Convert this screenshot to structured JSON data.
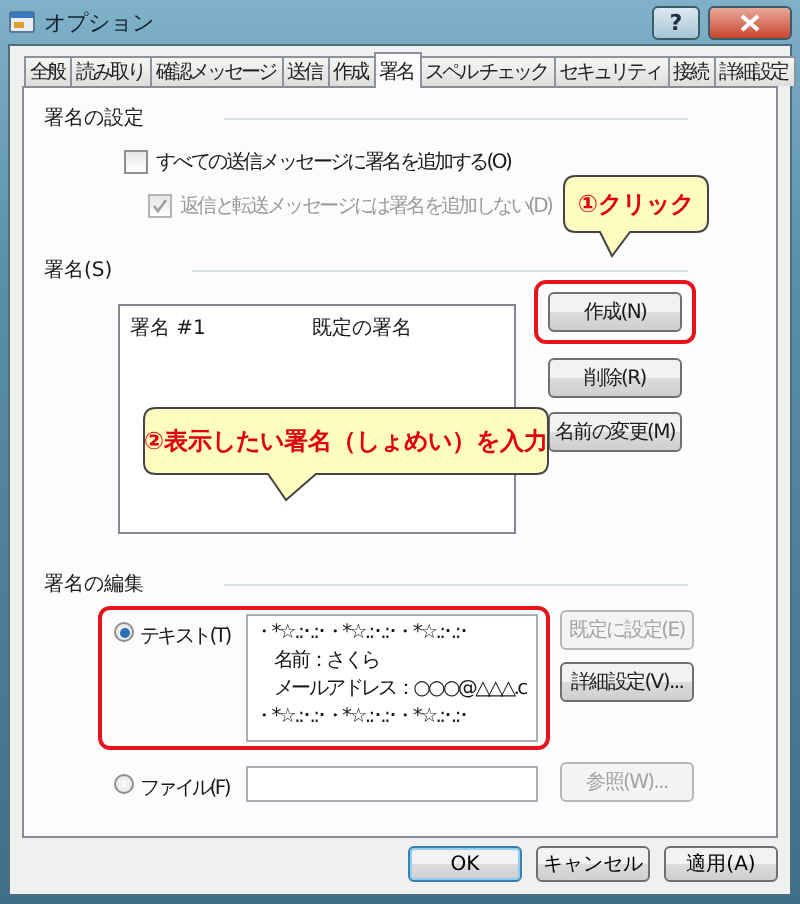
{
  "window": {
    "title": "オプション",
    "help_button": "?"
  },
  "tabs": [
    {
      "label": "全般",
      "selected": false
    },
    {
      "label": "読み取り",
      "selected": false
    },
    {
      "label": "確認メッセージ",
      "selected": false
    },
    {
      "label": "送信",
      "selected": false
    },
    {
      "label": "作成",
      "selected": false
    },
    {
      "label": "署名",
      "selected": true
    },
    {
      "label": "スペル チェック",
      "selected": false
    },
    {
      "label": "セキュリティ",
      "selected": false
    },
    {
      "label": "接続",
      "selected": false
    },
    {
      "label": "詳細設定",
      "selected": false
    }
  ],
  "signature_settings": {
    "heading": "署名の設定",
    "options": [
      {
        "label": "すべての送信メッセージに署名を追加する(O)",
        "checked": false,
        "disabled": false
      },
      {
        "label": "返信と転送メッセージには署名を追加しない(D)",
        "checked": true,
        "disabled": true
      }
    ]
  },
  "signatures": {
    "heading": "署名(S)",
    "rows": [
      {
        "name": "署名 #1",
        "note": "既定の署名",
        "selected": false
      }
    ],
    "buttons": [
      {
        "label": "作成(N)",
        "disabled": false,
        "highlighted": true
      },
      {
        "label": "削除(R)",
        "disabled": false,
        "highlighted": false
      },
      {
        "label": "名前の変更(M)",
        "disabled": false,
        "highlighted": false
      }
    ]
  },
  "signature_edit": {
    "heading": "署名の編集",
    "sources": [
      {
        "label": "テキスト(T)",
        "kind": "text",
        "selected": true,
        "highlighted": true,
        "lines": [
          {
            "text": "・*☆.:･.:･・*☆.:･.:･・*☆.:･.:･",
            "kind": "border"
          },
          {
            "text": "名前：さくら",
            "kind": "field"
          },
          {
            "text": "メールアドレス：○○○@△△△.c",
            "kind": "field"
          },
          {
            "text": "・*☆.:･.:･・*☆.:･.:･・*☆.:･.:･",
            "kind": "border"
          }
        ],
        "buttons": [
          {
            "label": "既定に設定(E)",
            "disabled": true
          },
          {
            "label": "詳細設定(V)...",
            "disabled": false
          }
        ]
      },
      {
        "label": "ファイル(F)",
        "kind": "file",
        "selected": false,
        "highlighted": false,
        "buttons": [
          {
            "label": "参照(W)...",
            "disabled": true
          }
        ]
      }
    ]
  },
  "callouts": [
    {
      "text": "①クリック"
    },
    {
      "text": "②表示したい署名（しょめい）を入力"
    }
  ],
  "dialog_buttons": [
    {
      "label": "OK",
      "default": true
    },
    {
      "label": "キャンセル",
      "default": false
    },
    {
      "label": "適用(A)",
      "default": false
    }
  ]
}
